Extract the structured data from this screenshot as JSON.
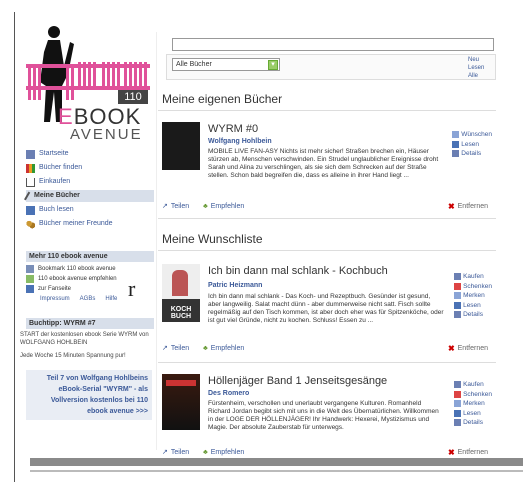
{
  "logo": {
    "number": "110",
    "word1_first": "E",
    "word1_rest": "BOOK",
    "word2": "AVENUE"
  },
  "nav": [
    {
      "label": "Startseite",
      "icon": "grid-icon",
      "active": false
    },
    {
      "label": "Bücher finden",
      "icon": "books-icon",
      "active": false
    },
    {
      "label": "Einkaufen",
      "icon": "cart-icon",
      "active": false
    },
    {
      "label": "Meine Bücher",
      "icon": "pencil-icon",
      "active": true
    },
    {
      "label": "Buch lesen",
      "icon": "book-icon",
      "active": false
    },
    {
      "label": "Bücher meiner Freunde",
      "icon": "friends-icon",
      "active": false
    }
  ],
  "mehr": {
    "heading": "Mehr 110 ebook avenue",
    "items": [
      "Bookmark 110 ebook avenue",
      "110 ebook avenue empfehlen",
      "zur Fanseite"
    ],
    "links": [
      "Impressum",
      "AGBs",
      "Hilfe"
    ]
  },
  "wyrm_box": {
    "heading": "Buchtipp: WYRM #7",
    "text1": "START der kostenlosen ebook Serie WYRM von WOLFGANG HOHLBEIN",
    "text2": "Jede Woche 15 Minuten Spannung pur!",
    "promo": "Teil 7 von Wolfgang Hohlbeins eBook-Serial \"WYRM\" - als Vollversion kostenlos bei 110 ebook avenue >>>"
  },
  "search": {
    "value": ""
  },
  "filter": {
    "selected": "Alle Bücher",
    "arrow": "▾",
    "links": [
      "Neu",
      "Lesen",
      "Alle"
    ]
  },
  "sections": {
    "own": "Meine eigenen Bücher",
    "wish": "Meine Wunschliste"
  },
  "own_books": [
    {
      "title": "WYRM #0",
      "author": "Wolfgang Hohlbein",
      "cover_text": "",
      "description": "MOBILE LIVE FAN-ASY Nichts ist mehr sicher! Straßen brechen ein, Häuser stürzen ab, Menschen verschwinden. Ein Strudel unglaublicher Ereignisse droht Sarah und Alina zu verschlingen, als sie sich dem Schrecken auf der Straße stellen. Schon bald begreifen die, dass es alleine in ihrer Hand liegt ...",
      "actions": [
        "Teilen",
        "Empfehlen"
      ],
      "side": [
        "Wünschen",
        "Lesen",
        "Details"
      ],
      "remove": "Entfernen"
    }
  ],
  "wish_books": [
    {
      "title": "Ich bin dann mal schlank - Kochbuch",
      "author": "Patric Heizmann",
      "cover_text": "KOCH BUCH",
      "description": "Ich bin dann mal schlank - Das Koch- und Rezeptbuch. Gesünder ist gesund, aber langweilig. Salat macht dünn - aber dummerweise nicht satt. Fisch sollte regelmäßig auf den Tisch kommen, ist aber doch eher was für Spitzenköche, oder ist gut viel Gründe, nicht zu kochen. Schluss! Essen zu ...",
      "actions": [
        "Teilen",
        "Empfehlen"
      ],
      "side": [
        "Kaufen",
        "Schenken",
        "Merken",
        "Lesen",
        "Details"
      ],
      "remove": "Entfernen"
    },
    {
      "title": "Höllenjäger Band 1 Jenseitsgesänge",
      "author": "Des Romero",
      "cover_text": "",
      "description": "Fürstenheim, verschollen und unerlaubt vergangene Kulturen. Romanheld Richard Jordan begibt sich mit uns in die Welt des Übernatürlichen. Willkommen in der LOGE DER HÖLLENJÄGER! Ihr Handwerk: Hexerei, Mystizismus und Magie. Der absolute Zauberstab für unterwegs.",
      "actions": [
        "Teilen",
        "Empfehlen"
      ],
      "side": [
        "Kaufen",
        "Schenken",
        "Merken",
        "Lesen",
        "Details"
      ],
      "remove": "Entfernen"
    }
  ],
  "edge_glyph": "r",
  "colors": {
    "brand_pink": "#e0519a",
    "link_blue": "#3b5998",
    "nav_active": "#d8dfea"
  }
}
